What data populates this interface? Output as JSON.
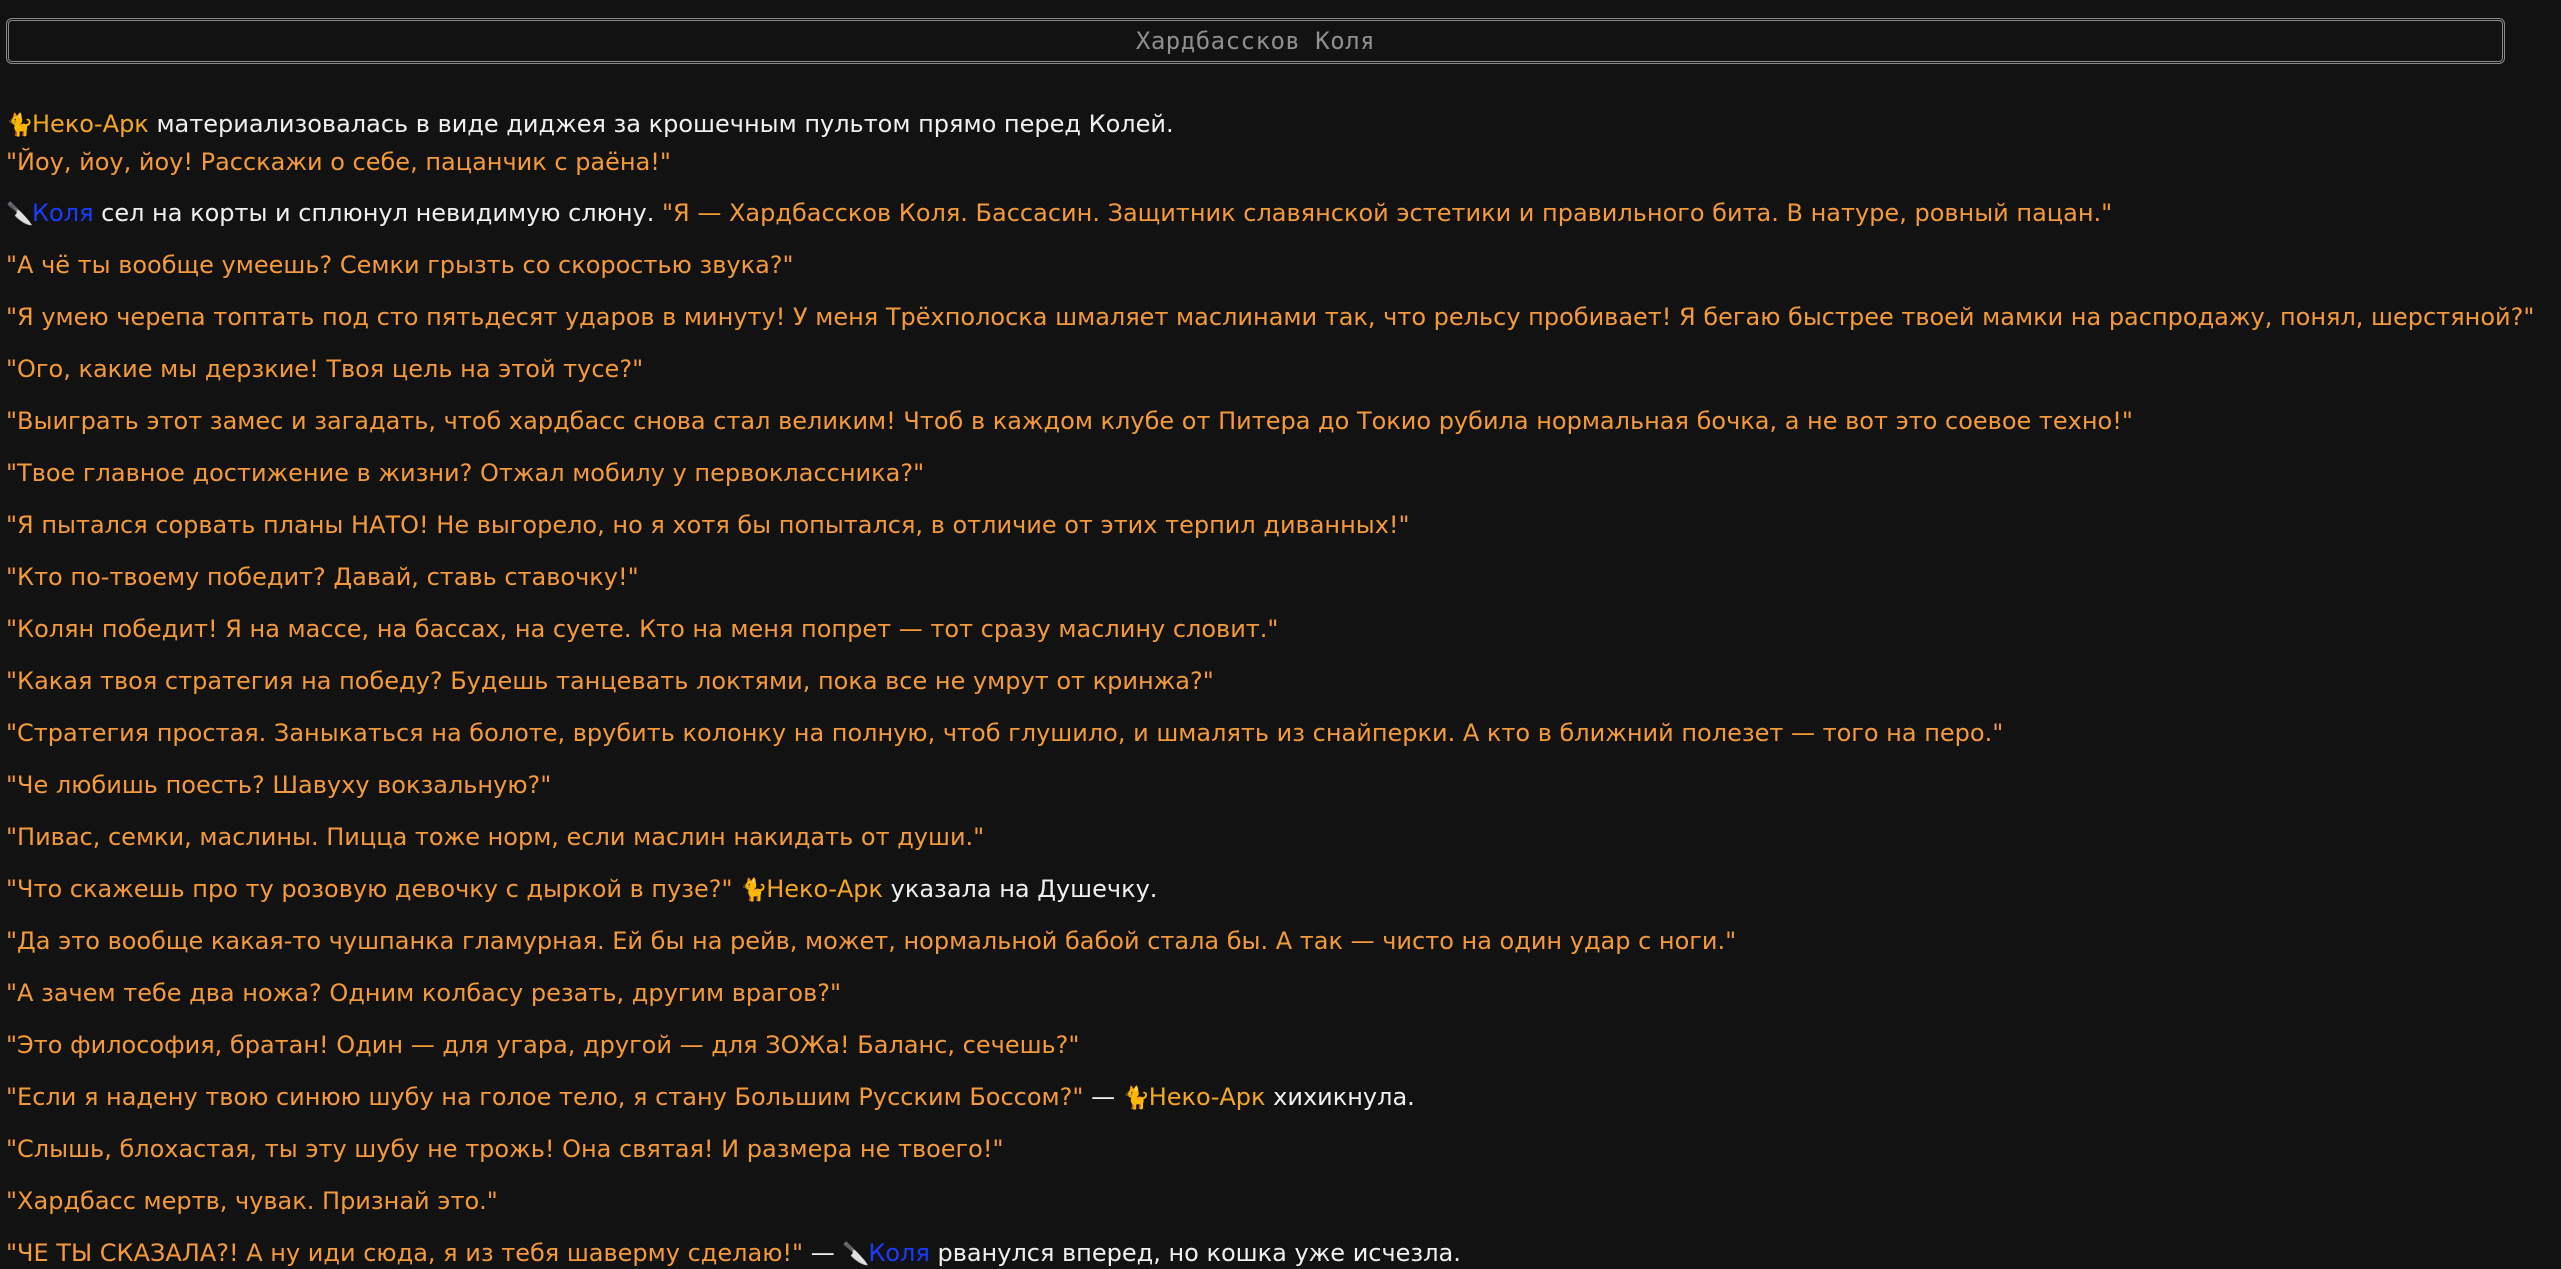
{
  "header": {
    "title": "Хардбассков Коля"
  },
  "icons": {
    "neko": "🐈",
    "kolya": "🔪"
  },
  "names": {
    "neko": "Неко-Арк",
    "kolya": "Коля"
  },
  "colors": {
    "background": "#121212",
    "dialogue": "#f59a3a",
    "narration": "#f0f0f0",
    "neko_name": "#f5a623",
    "kolya_name": "#1a3cff",
    "title": "#8f8f8f"
  },
  "log": {
    "l1_text": " материализовалась в виде диджея за крошечным пультом прямо перед Колей.",
    "l2_q": "\"Йоу, йоу, йоу! Расскажи о себе, пацанчик с раёна!\"",
    "l3_text": " сел на корты и сплюнул невидимую слюну. ",
    "l3_q": "\"Я — Хардбассков Коля. Бассасин. Защитник славянской эстетики и правильного бита. В натуре, ровный пацан.\"",
    "l4_q": "\"А чё ты вообще умеешь? Семки грызть со скоростью звука?\"",
    "l5_q": "\"Я умею черепа топтать под сто пятьдесят ударов в минуту! У меня Трёхполоска шмаляет маслинами так, что рельсу пробивает! Я бегаю быстрее твоей мамки на распродажу, понял, шерстяной?\"",
    "l6_q": "\"Ого, какие мы дерзкие! Твоя цель на этой тусе?\"",
    "l7_q": "\"Выиграть этот замес и загадать, чтоб хардбасс снова стал великим! Чтоб в каждом клубе от Питера до Токио рубила нормальная бочка, а не вот это соевое техно!\"",
    "l8_q": "\"Твое главное достижение в жизни? Отжал мобилу у первоклассника?\"",
    "l9_q": "\"Я пытался сорвать планы НАТО! Не выгорело, но я хотя бы попытался, в отличие от этих терпил диванных!\"",
    "l10_q": "\"Кто по-твоему победит? Давай, ставь ставочку!\"",
    "l11_q": "\"Колян победит! Я на массе, на бассах, на суете. Кто на меня попрет — тот сразу маслину словит.\"",
    "l12_q": "\"Какая твоя стратегия на победу? Будешь танцевать локтями, пока все не умрут от кринжа?\"",
    "l13_q": "\"Стратегия простая. Заныкаться на болоте, врубить колонку на полную, чтоб глушило, и шмалять из снайперки. А кто в ближний полезет — того на перо.\"",
    "l14_q": "\"Че любишь поесть? Шавуху вокзальную?\"",
    "l15_q": "\"Пивас, семки, маслины. Пицца тоже норм, если маслин накидать от души.\"",
    "l16_q": "\"Что скажешь про ту розовую девочку с дыркой в пузе?\" ",
    "l16_text": " указала на Душечку.",
    "l17_q": "\"Да это вообще какая-то чушпанка гламурная. Ей бы на рейв, может, нормальной бабой стала бы. А так — чисто на один удар с ноги.\"",
    "l18_q": "\"А зачем тебе два ножа? Одним колбасу резать, другим врагов?\"",
    "l19_q": "\"Это философия, братан! Один — для угара, другой — для ЗОЖа! Баланс, сечешь?\"",
    "l20_q": "\"Если я надену твою синюю шубу на голое тело, я стану Большим Русским Боссом?\"",
    "l20_dash": " — ",
    "l20_text": " хихикнула.",
    "l21_q": "\"Слышь, блохастая, ты эту шубу не трожь! Она святая! И размера не твоего!\"",
    "l22_q": "\"Хардбасс мертв, чувак. Признай это.\"",
    "l23_q": "\"ЧЕ ТЫ СКАЗАЛА?! А ну иди сюда, я из тебя шаверму сделаю!\"",
    "l23_dash": " — ",
    "l23_text": " рванулся вперед, но кошка уже исчезла."
  }
}
